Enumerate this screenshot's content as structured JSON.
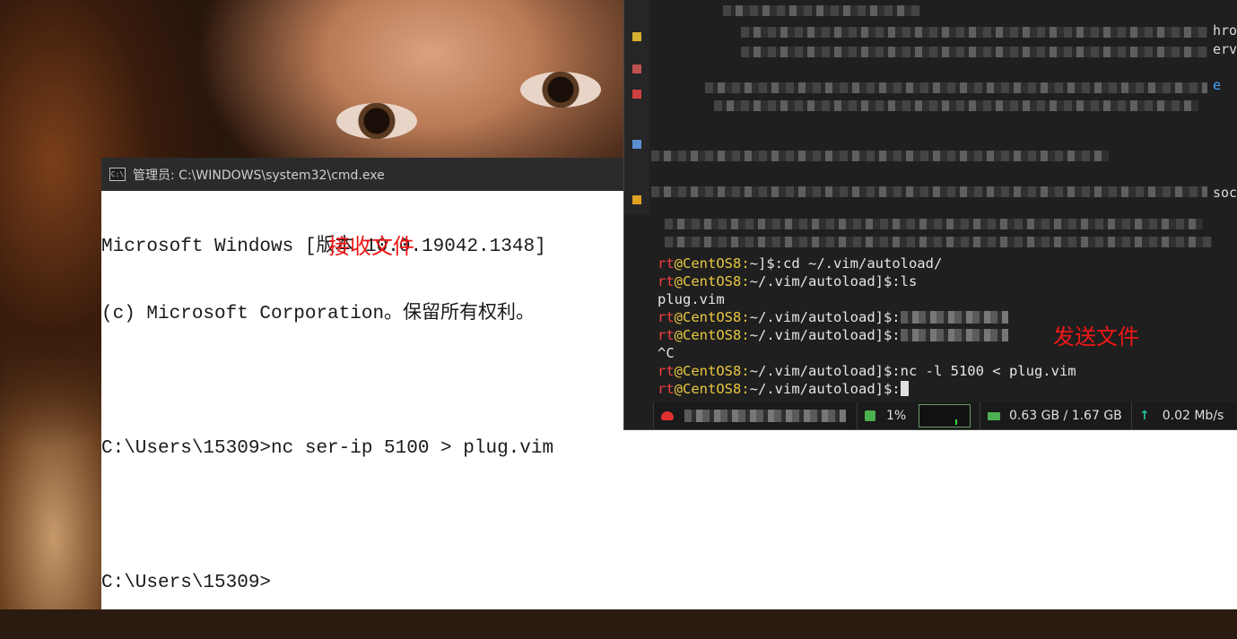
{
  "cmd": {
    "title": "管理员: C:\\WINDOWS\\system32\\cmd.exe",
    "lines": [
      "Microsoft Windows [版本 10.0.19042.1348]",
      "(c) Microsoft Corporation。保留所有权利。",
      "",
      "C:\\Users\\15309>nc ser-ip 5100 > plug.vim",
      "",
      "C:\\Users\\15309>"
    ],
    "annotation": "接收文件"
  },
  "terminal": {
    "prompt_user": "rt",
    "prompt_host": "@CentOS8:",
    "lines": [
      {
        "path": "~]$:",
        "cmd": "cd ~/.vim/autoload/"
      },
      {
        "path": "~/.vim/autoload]$:",
        "cmd": "ls"
      },
      {
        "output": "plug.vim"
      },
      {
        "path": "~/.vim/autoload]$:",
        "cmd": "",
        "redacted": true
      },
      {
        "path": "~/.vim/autoload]$:",
        "cmd": "",
        "redacted": true
      },
      {
        "output": "^C"
      },
      {
        "path": "~/.vim/autoload]$:",
        "cmd": "nc -l 5100 < plug.vim"
      },
      {
        "path": "~/.vim/autoload]$:",
        "cmd": "",
        "cursor": true
      }
    ],
    "annotation": "发送文件",
    "edge_text": [
      "hro",
      "erv",
      "e",
      "soc"
    ],
    "status_bar": {
      "cpu": "1%",
      "memory": "0.63 GB / 1.67 GB",
      "network": "0.02 Mb/s"
    }
  }
}
